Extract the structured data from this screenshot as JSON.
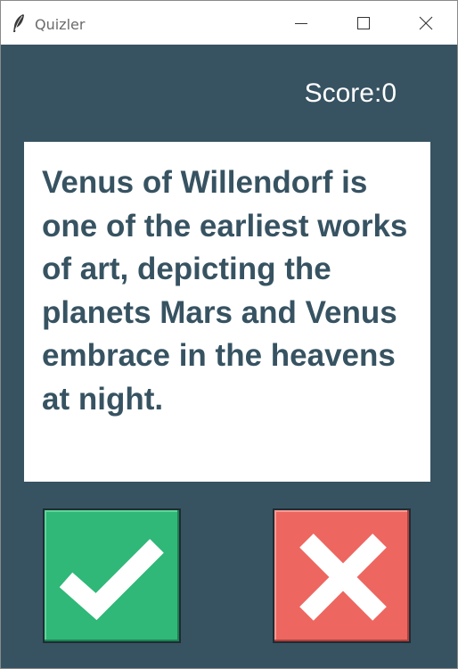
{
  "window": {
    "title": "Quizler"
  },
  "quiz": {
    "score_label": "Score:0",
    "question": "Venus of Willendorf is one of the earliest works of art, depicting the planets Mars and Venus embrace in the heavens at night."
  },
  "buttons": {
    "true_icon": "check-icon",
    "false_icon": "cross-icon"
  },
  "colors": {
    "background": "#375362",
    "true_button": "#2fb877",
    "false_button": "#ee6660",
    "card": "#ffffff",
    "question_text": "#375362"
  }
}
